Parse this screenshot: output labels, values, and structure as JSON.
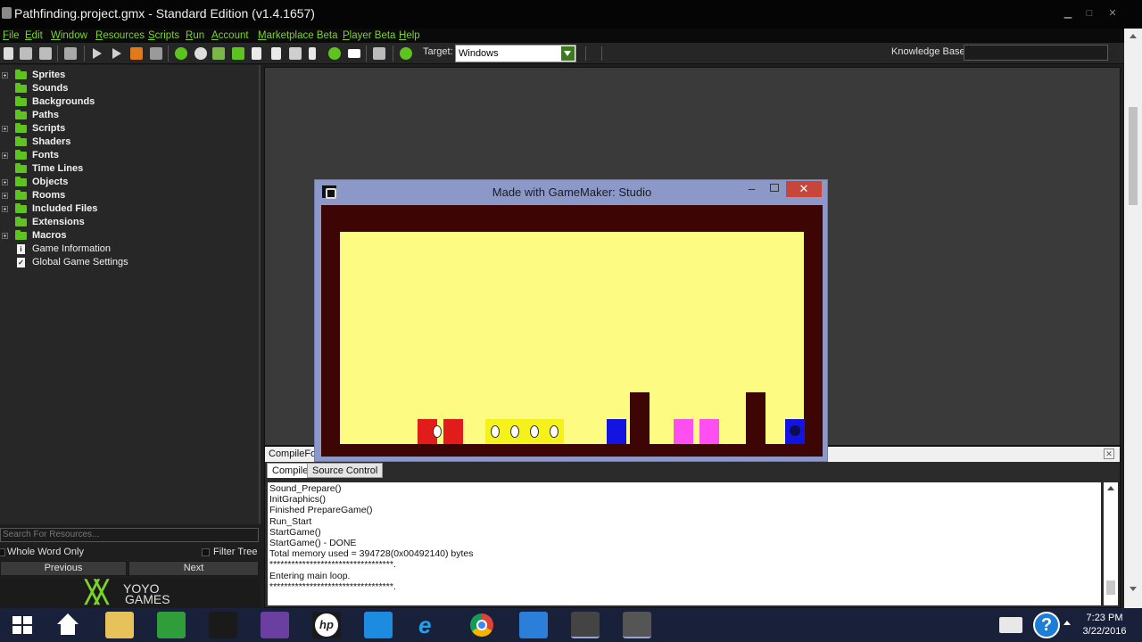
{
  "window": {
    "title": "Pathfinding.project.gmx  -  Standard Edition (v1.4.1657)"
  },
  "menu": [
    "File",
    "Edit",
    "Window",
    "Resources",
    "Scripts",
    "Run",
    "Account",
    "Marketplace Beta",
    "Player Beta",
    "Help"
  ],
  "toolbar": {
    "target_label": "Target:",
    "target_value": "Windows",
    "knowledge_base_label": "Knowledge Base:"
  },
  "tree": [
    {
      "label": "Sprites",
      "type": "folder",
      "expandable": true
    },
    {
      "label": "Sounds",
      "type": "folder",
      "expandable": false
    },
    {
      "label": "Backgrounds",
      "type": "folder",
      "expandable": false
    },
    {
      "label": "Paths",
      "type": "folder",
      "expandable": false
    },
    {
      "label": "Scripts",
      "type": "folder",
      "expandable": true
    },
    {
      "label": "Shaders",
      "type": "folder",
      "expandable": false
    },
    {
      "label": "Fonts",
      "type": "folder",
      "expandable": true
    },
    {
      "label": "Time Lines",
      "type": "folder",
      "expandable": false
    },
    {
      "label": "Objects",
      "type": "folder",
      "expandable": true
    },
    {
      "label": "Rooms",
      "type": "folder",
      "expandable": true
    },
    {
      "label": "Included Files",
      "type": "folder",
      "expandable": true
    },
    {
      "label": "Extensions",
      "type": "folder",
      "expandable": false
    },
    {
      "label": "Macros",
      "type": "folder",
      "expandable": true
    },
    {
      "label": "Game Information",
      "type": "doc",
      "expandable": false
    },
    {
      "label": "Global Game Settings",
      "type": "doc",
      "expandable": false
    }
  ],
  "search": {
    "placeholder": "Search For Resources..."
  },
  "filters": {
    "whole_word": "Whole Word Only",
    "filter_tree": "Filter Tree"
  },
  "nav": {
    "previous": "Previous",
    "next": "Next"
  },
  "brand": {
    "line1": "YOYO",
    "line2": "GAMES"
  },
  "game_window": {
    "title": "Made with GameMaker: Studio",
    "colors": {
      "frame": "#3e0505",
      "floor": "#fdfb82",
      "red": "#e21b1b",
      "blue": "#1414e0",
      "pink": "#ff4ff0",
      "wall": "#3e0505",
      "yellow": "#f4f11c"
    }
  },
  "output": {
    "header": "CompileForm",
    "tabs": [
      "Compile",
      "Source Control"
    ],
    "lines": [
      "Sound_Prepare()",
      "InitGraphics()",
      "Finished PrepareGame()",
      "Run_Start",
      "StartGame()",
      "StartGame() - DONE",
      "Total memory used = 394728(0x00492140) bytes",
      "**********************************.",
      "Entering main loop.",
      "**********************************."
    ]
  },
  "clock": {
    "time": "7:23 PM",
    "date": "3/22/2016"
  },
  "taskbar_icons": [
    "windows-start-icon",
    "home-icon",
    "file-explorer-icon",
    "store-icon",
    "camera-icon",
    "photo-app-icon",
    "hp-icon",
    "onedrive-icon",
    "internet-explorer-icon",
    "chrome-icon",
    "mail-icon",
    "gamemaker-icon",
    "gamemaker-runner-icon"
  ]
}
